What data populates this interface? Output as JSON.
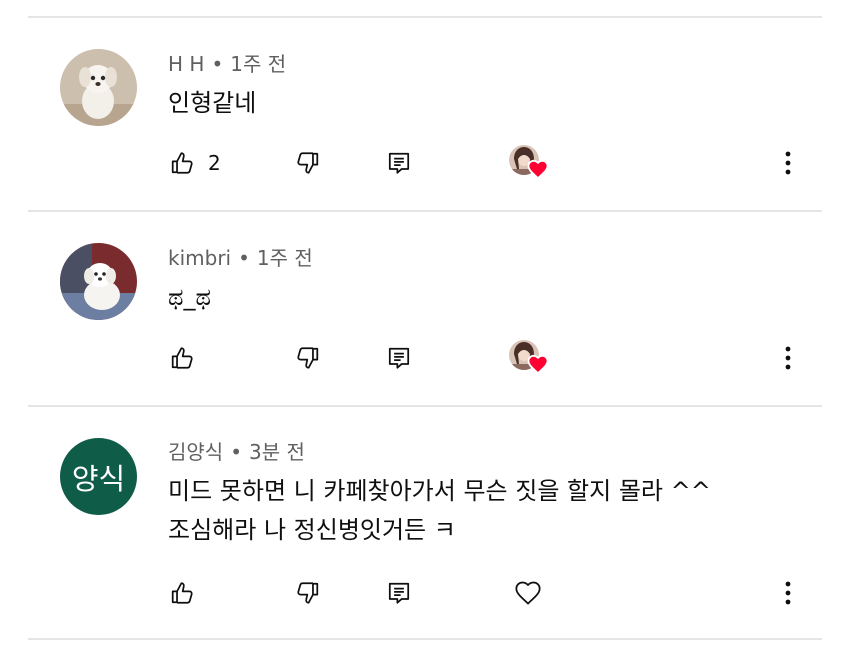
{
  "comments": [
    {
      "author": "H H",
      "time": "1주 전",
      "lines": [
        "인형같네"
      ],
      "likes": "2",
      "avatar": "white-puppy-photo",
      "creator_hearted": true
    },
    {
      "author": "kimbri",
      "time": "1주 전",
      "lines": [
        "ಥ_ಥ"
      ],
      "likes": "",
      "avatar": "white-puppy-on-sofa-photo",
      "creator_hearted": true
    },
    {
      "author": "김양식",
      "time": "3분 전",
      "lines": [
        "미드 못하면 니 카페찾아가서 무슨 짓을 할지 몰라 ^^",
        "조심해라 나 정신병잇거든 ㅋ"
      ],
      "likes": "",
      "avatar_initials": "양식",
      "avatar_color": "#0f5c49",
      "creator_hearted": false
    }
  ],
  "separator": "•",
  "icons": {
    "like": "thumb-up-icon",
    "dislike": "thumb-down-icon",
    "reply": "reply-icon",
    "heart": "heart-outline-icon",
    "creator_heart": "creator-heart-icon",
    "more": "more-vert-icon"
  },
  "colors": {
    "meta_text": "#606060",
    "text": "#0f0f0f",
    "heart_red": "#ff0033",
    "avatar_green": "#0f5c49",
    "divider": "#e5e5e5"
  }
}
